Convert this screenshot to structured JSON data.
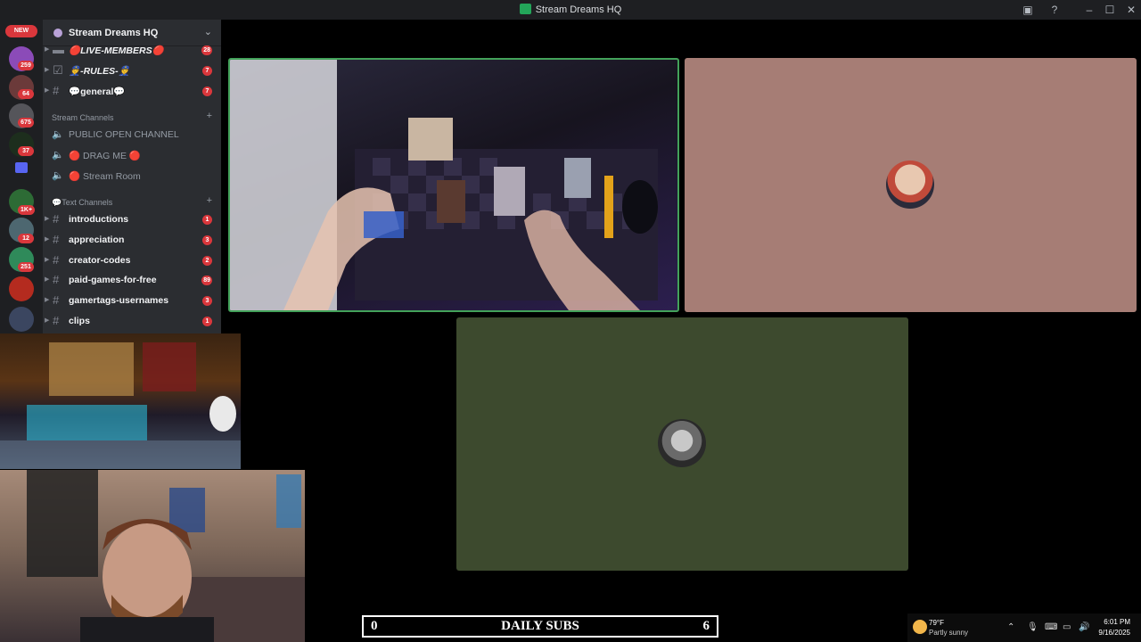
{
  "window": {
    "title": "Stream Dreams HQ",
    "controls": [
      "minimize-icon",
      "maximize-icon",
      "close-icon"
    ],
    "toolbar_icons": [
      "inbox-icon",
      "help-icon"
    ]
  },
  "rail": {
    "new_label": "NEW",
    "badges": [
      "259",
      "64",
      "675",
      "37",
      "1K+",
      "12",
      "251"
    ]
  },
  "server": {
    "name": "Stream Dreams HQ"
  },
  "channels_top": [
    {
      "label": "🔴LIVE-MEMBERS🔴",
      "count": "28"
    },
    {
      "label": "👮-RULES-👮",
      "count": "7"
    },
    {
      "label": "💬general💬",
      "count": "7"
    }
  ],
  "stream_category": "Stream Channels",
  "voice_channels": [
    {
      "label": "PUBLIC OPEN CHANNEL"
    },
    {
      "label": "🔴 DRAG ME 🔴"
    },
    {
      "label": "🔴 Stream Room"
    }
  ],
  "text_category": "💬Text Channels",
  "text_channels": [
    {
      "label": "introductions",
      "count": "1"
    },
    {
      "label": "appreciation",
      "count": "3"
    },
    {
      "label": "creator-codes",
      "count": "2"
    },
    {
      "label": "paid-games-for-free",
      "count": "89"
    },
    {
      "label": "gamertags-usernames",
      "count": "3"
    },
    {
      "label": "clips",
      "count": "1"
    }
  ],
  "subs_bar": {
    "left": "0",
    "label": "DAILY SUBS",
    "right": "6"
  },
  "tray": {
    "temperature": "79°F",
    "condition": "Partly sunny",
    "time": "6:01 PM",
    "date": "9/16/2025"
  },
  "colors": {
    "accent_green": "#23a559",
    "badge_red": "#da373c",
    "tile_user1": "#a67d75",
    "tile_user2": "#3d4a2e"
  }
}
